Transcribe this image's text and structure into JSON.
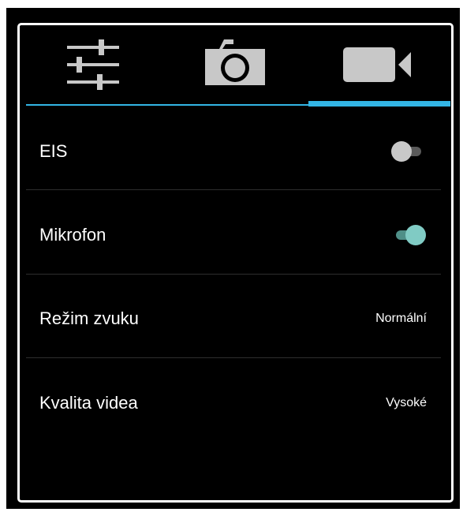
{
  "tabs": [
    {
      "name": "settings",
      "icon": "sliders-icon",
      "selected": false
    },
    {
      "name": "photo",
      "icon": "camera-icon",
      "selected": false
    },
    {
      "name": "video",
      "icon": "video-camera-icon",
      "selected": true
    }
  ],
  "colors": {
    "accent": "#33b5e5",
    "switch_on": "#80cbc4",
    "switch_off": "#c8c8c8",
    "icon": "#c8c8c8"
  },
  "settings": {
    "eis": {
      "label": "EIS",
      "enabled": false
    },
    "mikrofon": {
      "label": "Mikrofon",
      "enabled": true
    },
    "rezim_zvuku": {
      "label": "Režim zvuku",
      "value": "Normální"
    },
    "kvalita_videa": {
      "label": "Kvalita videa",
      "value": "Vysoké"
    }
  }
}
